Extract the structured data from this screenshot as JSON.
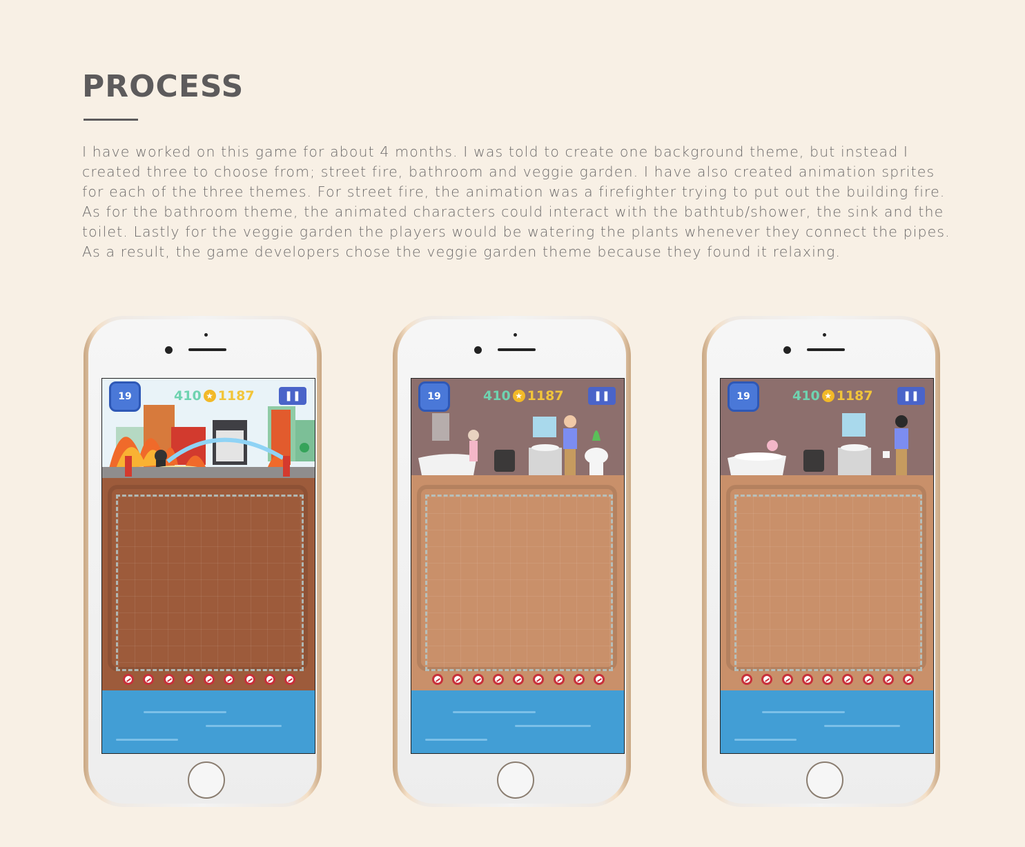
{
  "header": {
    "title": "PROCESS",
    "body": "I have worked on this game for about 4 months. I was told to create one background theme, but instead I created three to choose from; street fire, bathroom and veggie garden. I have also created animation sprites for each of the three themes. For street fire, the animation was a firefighter trying to put out the building fire. As for the bathroom theme, the animated characters could interact with the bathtub/shower, the sink and the toilet. Lastly for the veggie garden the players would be watering the plants whenever they connect the pipes. As a result, the game developers chose the veggie garden theme because they found it relaxing."
  },
  "phones": [
    {
      "theme": "street-fire",
      "level": "19",
      "score_left": "410",
      "score_right": "1187",
      "pause_icon": "pause-icon"
    },
    {
      "theme": "bathroom-shower",
      "level": "19",
      "score_left": "410",
      "score_right": "1187",
      "pause_icon": "pause-icon"
    },
    {
      "theme": "bathroom-bath",
      "level": "19",
      "score_left": "410",
      "score_right": "1187",
      "pause_icon": "pause-icon"
    }
  ],
  "colors": {
    "background": "#f8f0e5",
    "title": "#5d5b5c",
    "water": "#429ed5",
    "hud_blue": "#4a78d8",
    "score_green": "#6fd3b0",
    "score_gold": "#f2c53a"
  }
}
